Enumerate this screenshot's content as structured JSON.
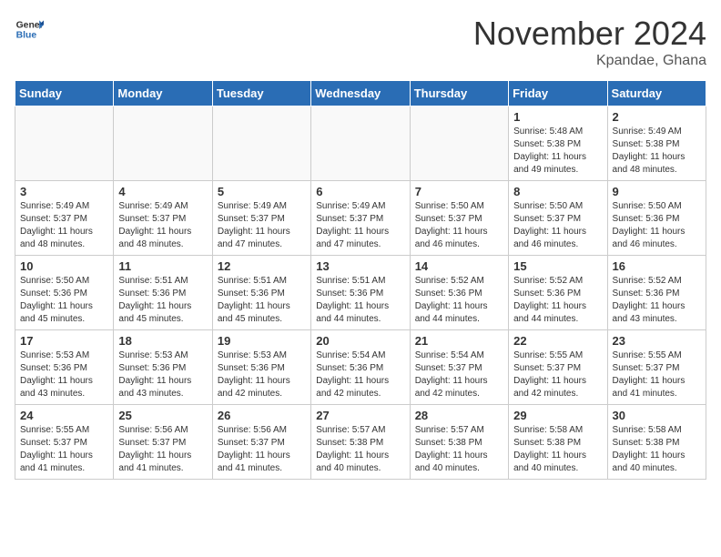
{
  "header": {
    "logo_line1": "General",
    "logo_line2": "Blue",
    "month": "November 2024",
    "location": "Kpandae, Ghana"
  },
  "weekdays": [
    "Sunday",
    "Monday",
    "Tuesday",
    "Wednesday",
    "Thursday",
    "Friday",
    "Saturday"
  ],
  "weeks": [
    [
      {
        "day": "",
        "info": ""
      },
      {
        "day": "",
        "info": ""
      },
      {
        "day": "",
        "info": ""
      },
      {
        "day": "",
        "info": ""
      },
      {
        "day": "",
        "info": ""
      },
      {
        "day": "1",
        "info": "Sunrise: 5:48 AM\nSunset: 5:38 PM\nDaylight: 11 hours\nand 49 minutes."
      },
      {
        "day": "2",
        "info": "Sunrise: 5:49 AM\nSunset: 5:38 PM\nDaylight: 11 hours\nand 48 minutes."
      }
    ],
    [
      {
        "day": "3",
        "info": "Sunrise: 5:49 AM\nSunset: 5:37 PM\nDaylight: 11 hours\nand 48 minutes."
      },
      {
        "day": "4",
        "info": "Sunrise: 5:49 AM\nSunset: 5:37 PM\nDaylight: 11 hours\nand 48 minutes."
      },
      {
        "day": "5",
        "info": "Sunrise: 5:49 AM\nSunset: 5:37 PM\nDaylight: 11 hours\nand 47 minutes."
      },
      {
        "day": "6",
        "info": "Sunrise: 5:49 AM\nSunset: 5:37 PM\nDaylight: 11 hours\nand 47 minutes."
      },
      {
        "day": "7",
        "info": "Sunrise: 5:50 AM\nSunset: 5:37 PM\nDaylight: 11 hours\nand 46 minutes."
      },
      {
        "day": "8",
        "info": "Sunrise: 5:50 AM\nSunset: 5:37 PM\nDaylight: 11 hours\nand 46 minutes."
      },
      {
        "day": "9",
        "info": "Sunrise: 5:50 AM\nSunset: 5:36 PM\nDaylight: 11 hours\nand 46 minutes."
      }
    ],
    [
      {
        "day": "10",
        "info": "Sunrise: 5:50 AM\nSunset: 5:36 PM\nDaylight: 11 hours\nand 45 minutes."
      },
      {
        "day": "11",
        "info": "Sunrise: 5:51 AM\nSunset: 5:36 PM\nDaylight: 11 hours\nand 45 minutes."
      },
      {
        "day": "12",
        "info": "Sunrise: 5:51 AM\nSunset: 5:36 PM\nDaylight: 11 hours\nand 45 minutes."
      },
      {
        "day": "13",
        "info": "Sunrise: 5:51 AM\nSunset: 5:36 PM\nDaylight: 11 hours\nand 44 minutes."
      },
      {
        "day": "14",
        "info": "Sunrise: 5:52 AM\nSunset: 5:36 PM\nDaylight: 11 hours\nand 44 minutes."
      },
      {
        "day": "15",
        "info": "Sunrise: 5:52 AM\nSunset: 5:36 PM\nDaylight: 11 hours\nand 44 minutes."
      },
      {
        "day": "16",
        "info": "Sunrise: 5:52 AM\nSunset: 5:36 PM\nDaylight: 11 hours\nand 43 minutes."
      }
    ],
    [
      {
        "day": "17",
        "info": "Sunrise: 5:53 AM\nSunset: 5:36 PM\nDaylight: 11 hours\nand 43 minutes."
      },
      {
        "day": "18",
        "info": "Sunrise: 5:53 AM\nSunset: 5:36 PM\nDaylight: 11 hours\nand 43 minutes."
      },
      {
        "day": "19",
        "info": "Sunrise: 5:53 AM\nSunset: 5:36 PM\nDaylight: 11 hours\nand 42 minutes."
      },
      {
        "day": "20",
        "info": "Sunrise: 5:54 AM\nSunset: 5:36 PM\nDaylight: 11 hours\nand 42 minutes."
      },
      {
        "day": "21",
        "info": "Sunrise: 5:54 AM\nSunset: 5:37 PM\nDaylight: 11 hours\nand 42 minutes."
      },
      {
        "day": "22",
        "info": "Sunrise: 5:55 AM\nSunset: 5:37 PM\nDaylight: 11 hours\nand 42 minutes."
      },
      {
        "day": "23",
        "info": "Sunrise: 5:55 AM\nSunset: 5:37 PM\nDaylight: 11 hours\nand 41 minutes."
      }
    ],
    [
      {
        "day": "24",
        "info": "Sunrise: 5:55 AM\nSunset: 5:37 PM\nDaylight: 11 hours\nand 41 minutes."
      },
      {
        "day": "25",
        "info": "Sunrise: 5:56 AM\nSunset: 5:37 PM\nDaylight: 11 hours\nand 41 minutes."
      },
      {
        "day": "26",
        "info": "Sunrise: 5:56 AM\nSunset: 5:37 PM\nDaylight: 11 hours\nand 41 minutes."
      },
      {
        "day": "27",
        "info": "Sunrise: 5:57 AM\nSunset: 5:38 PM\nDaylight: 11 hours\nand 40 minutes."
      },
      {
        "day": "28",
        "info": "Sunrise: 5:57 AM\nSunset: 5:38 PM\nDaylight: 11 hours\nand 40 minutes."
      },
      {
        "day": "29",
        "info": "Sunrise: 5:58 AM\nSunset: 5:38 PM\nDaylight: 11 hours\nand 40 minutes."
      },
      {
        "day": "30",
        "info": "Sunrise: 5:58 AM\nSunset: 5:38 PM\nDaylight: 11 hours\nand 40 minutes."
      }
    ]
  ]
}
